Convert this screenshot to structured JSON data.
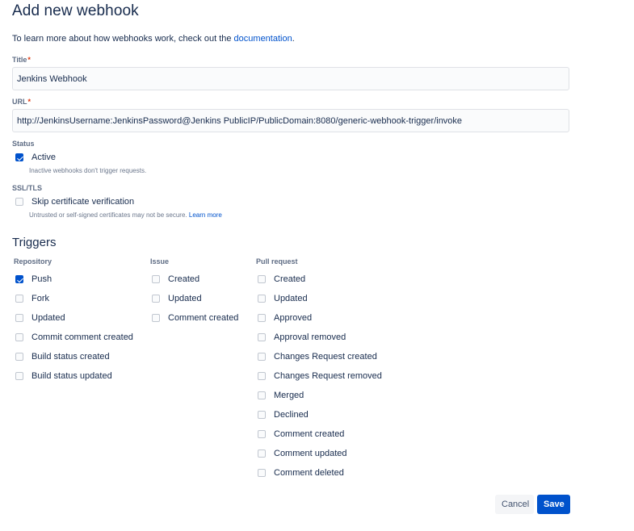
{
  "page": {
    "title": "Add new webhook",
    "intro_text": "To learn more about how webhooks work, check out the ",
    "intro_link": "documentation",
    "intro_suffix": "."
  },
  "form": {
    "title_label": "Title",
    "title_value": "Jenkins Webhook",
    "url_label": "URL",
    "url_value": "http://JenkinsUsername:JenkinsPassword@Jenkins PublicIP/PublicDomain:8080/generic-webhook-trigger/invoke",
    "required_marker": "*",
    "status_label": "Status",
    "active_label": "Active",
    "active_checked": true,
    "active_helper": "Inactive webhooks don't trigger requests.",
    "ssl_label": "SSL/TLS",
    "skip_cert_label": "Skip certificate verification",
    "skip_cert_checked": false,
    "skip_cert_helper": "Untrusted or self-signed certificates may not be secure.",
    "skip_cert_learn_more": "Learn more"
  },
  "triggers": {
    "title": "Triggers",
    "repository": {
      "header": "Repository",
      "items": [
        {
          "label": "Push",
          "checked": true
        },
        {
          "label": "Fork",
          "checked": false
        },
        {
          "label": "Updated",
          "checked": false
        },
        {
          "label": "Commit comment created",
          "checked": false
        },
        {
          "label": "Build status created",
          "checked": false
        },
        {
          "label": "Build status updated",
          "checked": false
        }
      ]
    },
    "issue": {
      "header": "Issue",
      "items": [
        {
          "label": "Created",
          "checked": false
        },
        {
          "label": "Updated",
          "checked": false
        },
        {
          "label": "Comment created",
          "checked": false
        }
      ]
    },
    "pull_request": {
      "header": "Pull request",
      "items": [
        {
          "label": "Created",
          "checked": false
        },
        {
          "label": "Updated",
          "checked": false
        },
        {
          "label": "Approved",
          "checked": false
        },
        {
          "label": "Approval removed",
          "checked": false
        },
        {
          "label": "Changes Request created",
          "checked": false
        },
        {
          "label": "Changes Request removed",
          "checked": false
        },
        {
          "label": "Merged",
          "checked": false
        },
        {
          "label": "Declined",
          "checked": false
        },
        {
          "label": "Comment created",
          "checked": false
        },
        {
          "label": "Comment updated",
          "checked": false
        },
        {
          "label": "Comment deleted",
          "checked": false
        }
      ]
    }
  },
  "actions": {
    "cancel_label": "Cancel",
    "save_label": "Save"
  },
  "colors": {
    "primary": "#0052cc",
    "text": "#172b4d",
    "subtle": "#5e6c84",
    "required": "#de350b"
  },
  "icons": {
    "checkbox_checked": "checkmark-icon"
  }
}
